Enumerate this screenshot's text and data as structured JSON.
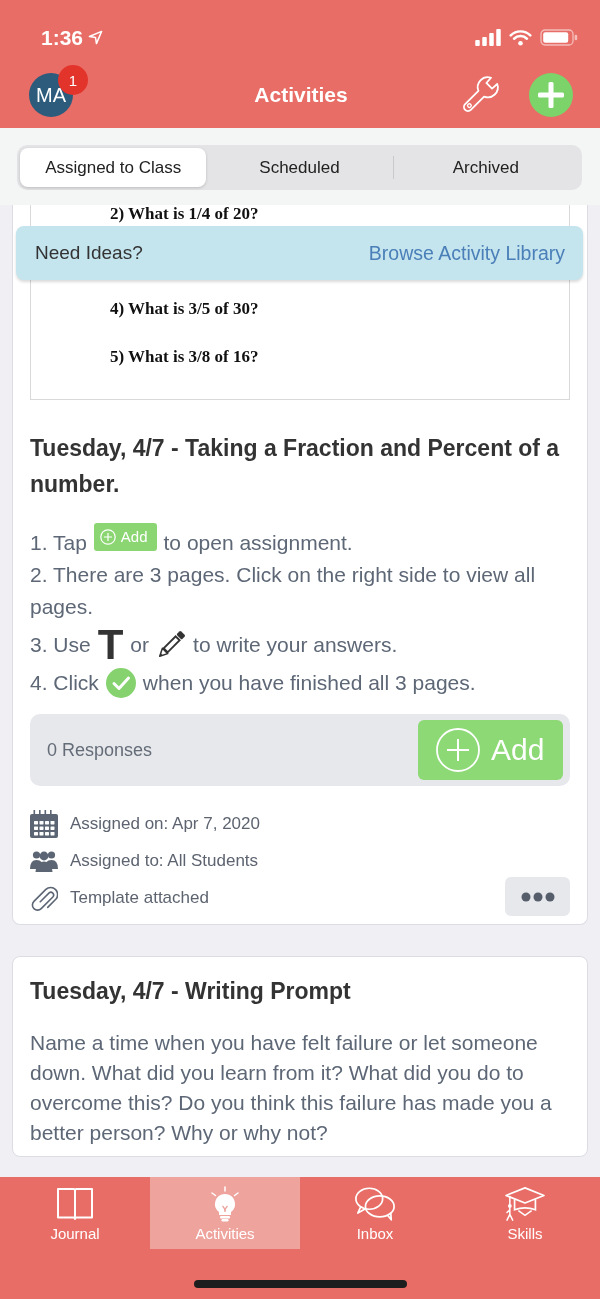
{
  "status_bar": {
    "time": "1:36"
  },
  "nav_bar": {
    "avatar_initials": "MA",
    "badge": "1",
    "title": "Activities"
  },
  "segments": [
    {
      "label": "Assigned to Class",
      "selected": true
    },
    {
      "label": "Scheduled",
      "selected": false
    },
    {
      "label": "Archived",
      "selected": false
    }
  ],
  "ideas_banner": {
    "prompt": "Need Ideas?",
    "link": "Browse Activity Library"
  },
  "activities": [
    {
      "kind": "worksheet",
      "worksheet_lines": [
        "2) What is 1/4 of 20?",
        "4) What is 3/5 of 30?",
        "5) What is 3/8 of 16?"
      ],
      "title": "Tuesday, 4/7 - Taking a Fraction and Percent of a number.",
      "instructions": [
        {
          "parts": [
            {
              "kind": "text",
              "text": "1. Tap"
            },
            {
              "kind": "add_chip",
              "text": "Add"
            },
            {
              "kind": "text",
              "text": "to open assignment."
            }
          ]
        },
        {
          "parts": [
            {
              "kind": "text",
              "text": "2. There are 3 pages. Click on the right side to view all pages."
            }
          ]
        },
        {
          "parts": [
            {
              "kind": "text",
              "text": "3. Use"
            },
            {
              "kind": "text_tool",
              "text": "T"
            },
            {
              "kind": "text",
              "text": "or"
            },
            {
              "kind": "pen_tool"
            },
            {
              "kind": "text",
              "text": "to write your answers."
            }
          ]
        },
        {
          "parts": [
            {
              "kind": "text",
              "text": "4. Click"
            },
            {
              "kind": "done_mark"
            },
            {
              "kind": "text",
              "text": "when you have finished all 3 pages."
            }
          ]
        }
      ],
      "responses": "0 Responses",
      "add_button": "Add",
      "details": [
        "Assigned on: Apr 7, 2020",
        "Assigned to: All Students",
        "Template attached"
      ]
    },
    {
      "kind": "prompt",
      "title": "Tuesday, 4/7 - Writing Prompt",
      "body": "Name a time when you have felt failure or let someone down. What did you learn from it? What did you do to overcome this? Do you think this failure has made you a better person? Why or why not?"
    }
  ],
  "tab_bar": [
    {
      "label": "Journal",
      "selected": false
    },
    {
      "label": "Activities",
      "selected": true
    },
    {
      "label": "Inbox",
      "selected": false
    },
    {
      "label": "Skills",
      "selected": false
    }
  ]
}
